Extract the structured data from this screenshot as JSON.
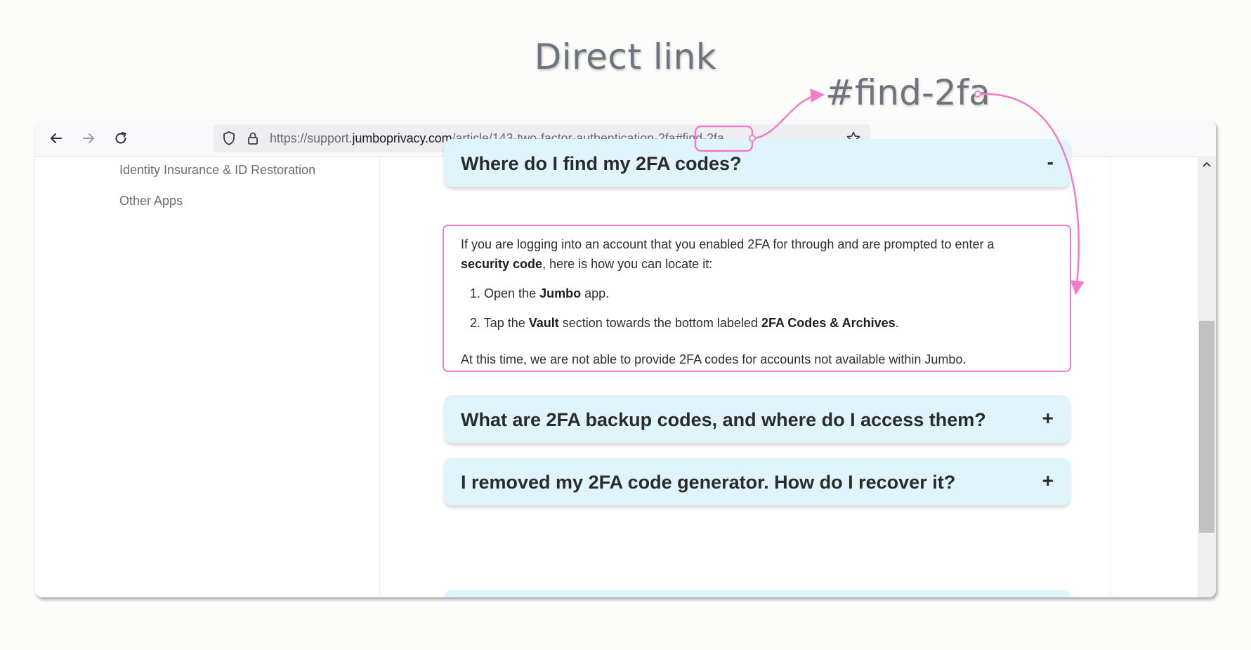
{
  "headline": "Direct link",
  "anchor_callout": "#find-2fa",
  "browser": {
    "nav": {
      "back_icon": "arrow-left-icon",
      "forward_icon": "arrow-right-icon",
      "reload_icon": "reload-icon"
    },
    "url": {
      "prefix": "https://support.",
      "domain": "jumboprivacy.com",
      "path": "/article/143-two-factor-authentication-2fa",
      "hash": "#find-2fa",
      "shield_icon": "shield-icon",
      "lock_icon": "lock-icon",
      "bookmark_icon": "star-icon"
    }
  },
  "sidebar": {
    "items": [
      {
        "label": "Identity Insurance & ID Restoration"
      },
      {
        "label": "Other Apps"
      }
    ]
  },
  "faq": {
    "items": [
      {
        "question": "Where do I find my 2FA codes?",
        "toggle": "-"
      },
      {
        "question": "What are 2FA backup codes, and where do I access them?",
        "toggle": "+"
      },
      {
        "question": "I removed my 2FA code generator. How do I recover it?",
        "toggle": "+"
      }
    ],
    "answer": {
      "intro_a": "If you are logging into an account that you enabled 2FA for through and are prompted to enter a ",
      "intro_bold": "security code",
      "intro_b": ", here is how you can locate it:",
      "steps": [
        {
          "num": "1.",
          "a": " Open the ",
          "bold": "Jumbo",
          "b": " app."
        },
        {
          "num": "2.",
          "a": " Tap the ",
          "bold": "Vault",
          "b": " section towards the bottom labeled ",
          "bold2": "2FA Codes & Archives",
          "c": "."
        }
      ],
      "footer": "At this time, we are not able to provide 2FA codes for accounts not available within Jumbo."
    }
  },
  "colors": {
    "highlight": "#f27cc8",
    "faq_background": "#e0f4fb"
  }
}
